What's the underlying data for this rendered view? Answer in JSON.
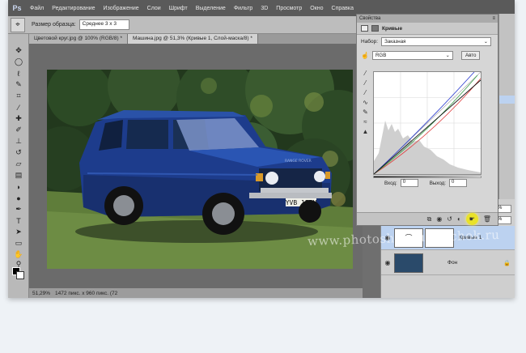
{
  "menu": {
    "items": [
      "Файл",
      "Редактирование",
      "Изображение",
      "Слои",
      "Шрифт",
      "Выделение",
      "Фильтр",
      "3D",
      "Просмотр",
      "Окно",
      "Справка"
    ]
  },
  "options_bar": {
    "sample_label": "Размер образца:",
    "sample_value": "Среднее 3 x 3"
  },
  "documents": {
    "tabs": [
      {
        "label": "Цветовой круг.jpg @ 100% (RGB/8) *"
      },
      {
        "label": "Машина.jpg @ 51,3% (Кривые 1, Слой-маска/8) *"
      }
    ]
  },
  "status": {
    "zoom": "51,29%",
    "doc_info": "1472 пикс. x 960 пикс. (72"
  },
  "properties": {
    "panel_title": "Свойства",
    "adjustment_title": "Кривые",
    "preset_label": "Набор:",
    "preset_value": "Заказная",
    "channel_value": "RGB",
    "auto_label": "Авто",
    "input_label": "Вход:",
    "input_value": "0",
    "output_label": "Выход:",
    "output_value": "0"
  },
  "layers": {
    "opacity_value": "100%",
    "fill_value": "100%",
    "items": [
      {
        "name": "Кривые 1"
      },
      {
        "name": "Фон"
      }
    ]
  },
  "watermark": {
    "text": "www.photoshopsunduchok.ru"
  },
  "car": {
    "plate": "YVB 153H",
    "hood_text": "RANGE ROVER"
  }
}
